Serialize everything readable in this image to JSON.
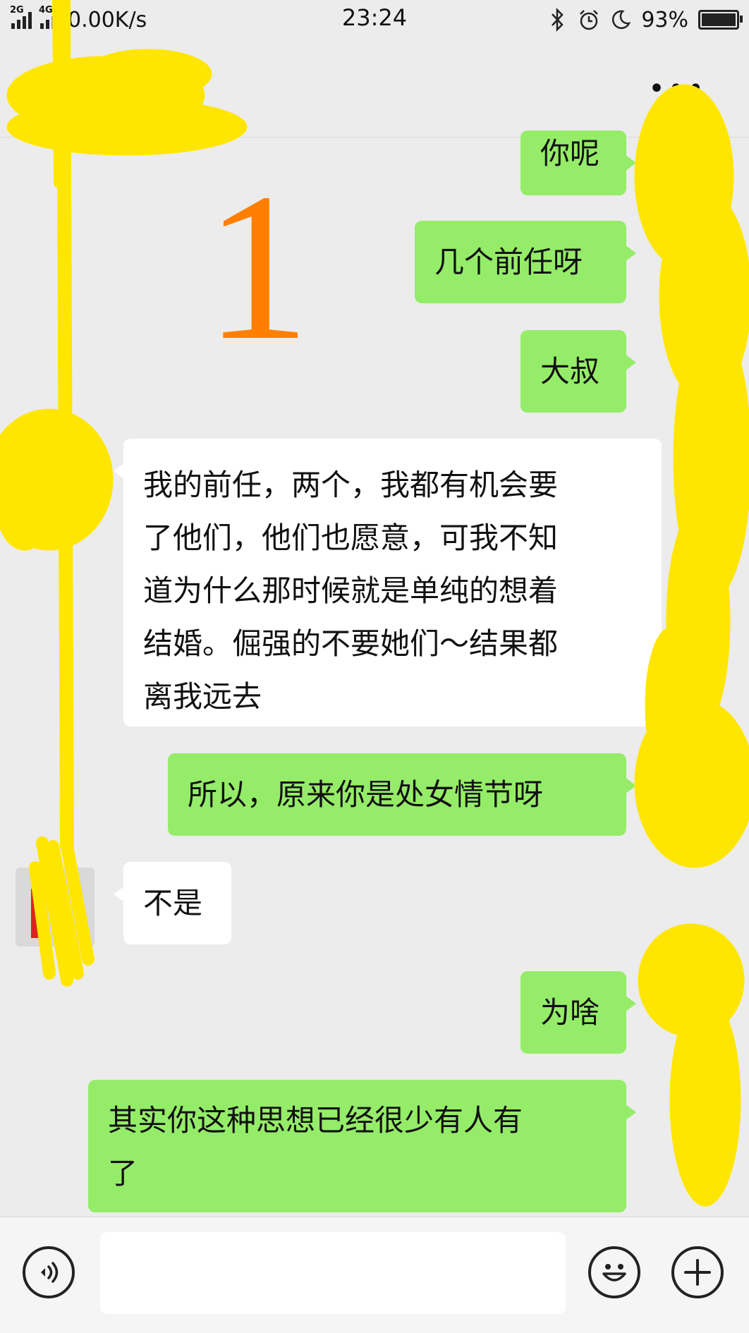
{
  "status_bar": {
    "signal1_tag": "2G",
    "signal2_tag": "4G",
    "net_speed": "0.00K/s",
    "time": "23:24",
    "icons": [
      "bluetooth-icon",
      "alarm-icon",
      "moon-icon"
    ],
    "battery_text": "93%",
    "battery_level": 0.93
  },
  "header": {
    "more_label": "•••"
  },
  "annotation": {
    "number": "1",
    "color": "#ff7f00",
    "scribble_color": "#ffe600"
  },
  "messages": [
    {
      "from": "me",
      "text": "你呢"
    },
    {
      "from": "me",
      "text": "几个前任呀"
    },
    {
      "from": "me",
      "text": "大叔"
    },
    {
      "from": "other",
      "lines": [
        "我的前任，两个，我都有机会要",
        "了他们，他们也愿意，可我不知",
        "道为什么那时候就是单纯的想着",
        "结婚。倔强的不要她们～结果都",
        "离我远去"
      ]
    },
    {
      "from": "me",
      "text": "所以，原来你是处女情节呀"
    },
    {
      "from": "other",
      "text": "不是"
    },
    {
      "from": "me",
      "text": "为啥"
    },
    {
      "from": "me",
      "lines": [
        "其实你这种思想已经很少有人有",
        "了"
      ]
    }
  ],
  "colors": {
    "me_bubble": "#95ec69",
    "other_bubble": "#ffffff",
    "background": "#ececec"
  },
  "input_bar": {
    "voice_icon": "voice-icon",
    "emoji_icon": "emoji-icon",
    "plus_icon": "plus-icon",
    "value": ""
  }
}
